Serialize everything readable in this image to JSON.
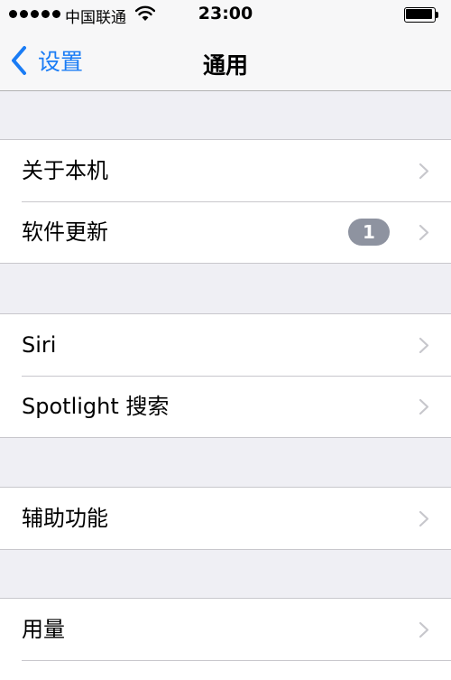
{
  "status_bar": {
    "carrier": "中国联通",
    "time": "23:00"
  },
  "nav": {
    "back_label": "设置",
    "title": "通用"
  },
  "groups": [
    {
      "items": [
        {
          "label": "关于本机"
        },
        {
          "label": "软件更新",
          "badge": "1"
        }
      ]
    },
    {
      "items": [
        {
          "label": "Siri"
        },
        {
          "label": "Spotlight 搜索"
        }
      ]
    },
    {
      "items": [
        {
          "label": "辅助功能"
        }
      ]
    },
    {
      "items": [
        {
          "label": "用量"
        }
      ]
    }
  ],
  "colors": {
    "accent": "#1a7cf5",
    "background": "#efeff4",
    "badge": "#8e93a0",
    "separator": "#c8c7cc"
  }
}
